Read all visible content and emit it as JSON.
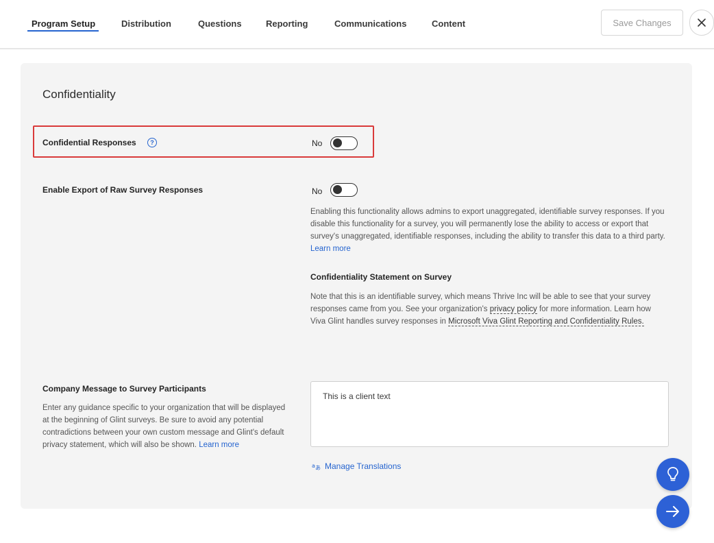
{
  "tabs": [
    {
      "label": "Program Setup",
      "active": true
    },
    {
      "label": "Distribution"
    },
    {
      "label": "Questions"
    },
    {
      "label": "Reporting"
    },
    {
      "label": "Communications"
    },
    {
      "label": "Content"
    }
  ],
  "toolbar": {
    "save_label": "Save Changes",
    "close_icon": "close-icon"
  },
  "confidentiality": {
    "title": "Confidentiality",
    "confidential_responses": {
      "label": "Confidential Responses",
      "help_glyph": "?",
      "state_text": "No",
      "enabled": false
    },
    "export_raw": {
      "label": "Enable Export of Raw Survey Responses",
      "state_text": "No",
      "enabled": false,
      "description": "Enabling this functionality allows admins to export unaggregated, identifiable survey responses. If you disable this functionality for a survey, you will permanently lose the ability to access or export that survey's unaggregated, identifiable responses, including the ability to transfer this data to a third party.",
      "learn_more": "Learn more"
    },
    "statement": {
      "heading": "Confidentiality Statement on Survey",
      "text_part1": "Note that this is an identifiable survey, which means Thrive Inc will be able to see that your survey responses came from you. See your organization's",
      "privacy_link": "privacy policy",
      "text_part2": "for more information. Learn how Viva Glint handles survey responses in",
      "rules_link": "Microsoft Viva Glint Reporting and Confidentiality Rules."
    }
  },
  "company_message": {
    "heading": "Company Message to Survey Participants",
    "description": "Enter any guidance specific to your organization that will be displayed at the beginning of Glint surveys. Be sure to avoid any potential contradictions between your own custom message and Glint's default privacy statement, which will also be shown.",
    "learn_more": "Learn more",
    "value": "This is a client text",
    "manage_translations": "Manage Translations"
  },
  "fabs": {
    "hint_icon": "lightbulb-icon",
    "next_icon": "arrow-right-icon"
  },
  "colors": {
    "accent": "#2564cf",
    "highlight": "#d93a3a",
    "panel": "#f4f4f4",
    "fab": "#2d61d6"
  }
}
